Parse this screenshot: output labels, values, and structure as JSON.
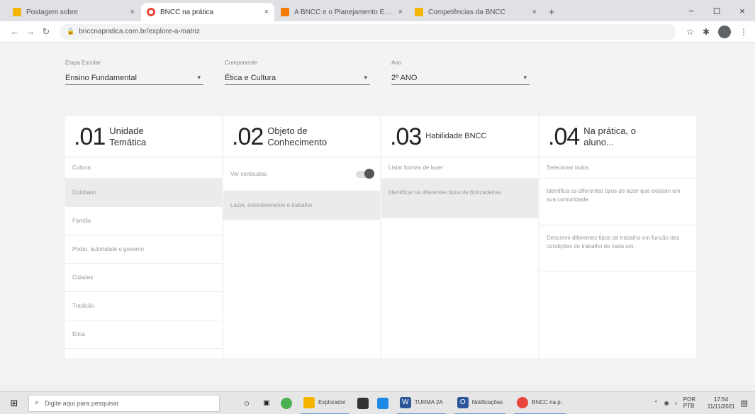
{
  "browser": {
    "tabs": [
      {
        "label": "Postagem sobre",
        "fav_color": "#f4b400",
        "active": false
      },
      {
        "label": "BNCC na prática",
        "fav_color": "#e8453c",
        "active": true
      },
      {
        "label": "A BNCC e o Planejamento Esco",
        "fav_color": "#f57c00",
        "active": false
      },
      {
        "label": "Competências da BNCC",
        "fav_color": "#f4b400",
        "active": false
      }
    ],
    "url": "bnccnapratica.com.br/explore-a-matriz",
    "window_controls": [
      "−",
      "◻",
      "×"
    ]
  },
  "filters": [
    {
      "label": "Etapa Escolar",
      "value": "Ensino Fundamental"
    },
    {
      "label": "Componente",
      "value": "Ética e Cultura"
    },
    {
      "label": "Ano",
      "value": "2º ANO"
    }
  ],
  "columns": [
    {
      "num": ".01",
      "title": "Unidade Temática",
      "rows": [
        "Cultura",
        "Cotidiano",
        "Família",
        "Poder, autoridade e governo",
        "Cidades",
        "Tradição",
        "Ética"
      ],
      "selected_index": 1
    },
    {
      "num": ".02",
      "title": "Objeto de Conhecimento",
      "toggle_label": "Ver conteúdos",
      "rows": [
        "Lazer, entretenimento e trabalho"
      ],
      "selected_index": 0
    },
    {
      "num": ".03",
      "title": "Habilidade BNCC",
      "rows": [
        "Listar formas de lazer",
        "Identificar os diferentes tipos de brincadeiras"
      ],
      "selected_index": 1
    },
    {
      "num": ".04",
      "title": "Na prática, o aluno...",
      "rows": [
        "Selecionar todos",
        "Identifica os diferentes tipos de lazer que existem em sua comunidade.",
        "Descreve diferentes tipos de trabalho em função das condições de trabalho de cada um."
      ]
    }
  ],
  "taskbar": {
    "search_placeholder": "Digite aqui para pesquisar",
    "apps": [
      {
        "label": "Explorador",
        "color": "#f4b400"
      },
      {
        "label": "TURMA 2A",
        "color": "#2b579a"
      },
      {
        "label": "Notificações",
        "color": "#2b579a"
      },
      {
        "label": "BNCC na p...",
        "color": "#e8453c"
      }
    ],
    "lang": "POR PTB",
    "time": "17:54",
    "date": "11/11/2021"
  }
}
